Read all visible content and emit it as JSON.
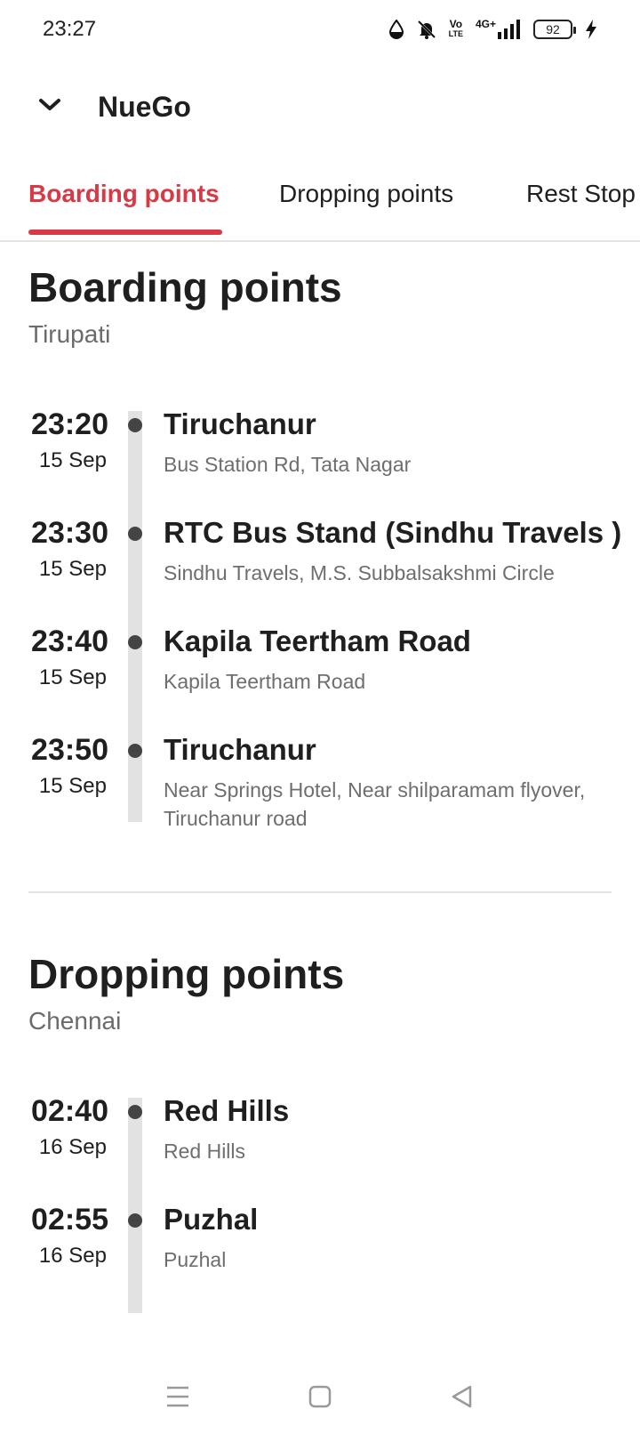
{
  "status_bar": {
    "time": "23:27",
    "network_top": "Vo",
    "network_bottom": "LTE",
    "network_type": "4G+",
    "battery_level": "92",
    "icons": [
      "water-drop-icon",
      "bell-off-icon",
      "volte-icon",
      "signal-icon",
      "battery-icon",
      "charging-icon"
    ]
  },
  "header": {
    "title": "NueGo",
    "collapse_icon": "chevron-down-icon"
  },
  "tabs": [
    {
      "label": "Boarding points",
      "active": true
    },
    {
      "label": "Dropping points",
      "active": false
    },
    {
      "label": "Rest Stop",
      "active": false
    }
  ],
  "boarding": {
    "title": "Boarding points",
    "city": "Tirupati",
    "stops": [
      {
        "time": "23:20",
        "date": "15 Sep",
        "name": "Tiruchanur",
        "address": "Bus Station Rd, Tata Nagar"
      },
      {
        "time": "23:30",
        "date": "15 Sep",
        "name": "RTC Bus Stand (Sindhu Travels )",
        "address": "Sindhu Travels, M.S. Subbalsakshmi Circle"
      },
      {
        "time": "23:40",
        "date": "15 Sep",
        "name": "Kapila Teertham Road",
        "address": "Kapila Teertham Road"
      },
      {
        "time": "23:50",
        "date": "15 Sep",
        "name": "Tiruchanur",
        "address": "Near Springs Hotel, Near shilparamam flyover, Tiruchanur road"
      }
    ]
  },
  "dropping": {
    "title": "Dropping points",
    "city": "Chennai",
    "stops": [
      {
        "time": "02:40",
        "date": "16 Sep",
        "name": "Red Hills",
        "address": "Red Hills"
      },
      {
        "time": "02:55",
        "date": "16 Sep",
        "name": "Puzhal",
        "address": "Puzhal"
      }
    ]
  },
  "colors": {
    "accent": "#d63a46",
    "text": "#1f1f1f",
    "muted": "#6e6e6e",
    "rail": "#e2e2e2"
  },
  "nav_bar": {
    "icons": [
      "menu-icon",
      "home-square-icon",
      "back-triangle-icon"
    ]
  }
}
